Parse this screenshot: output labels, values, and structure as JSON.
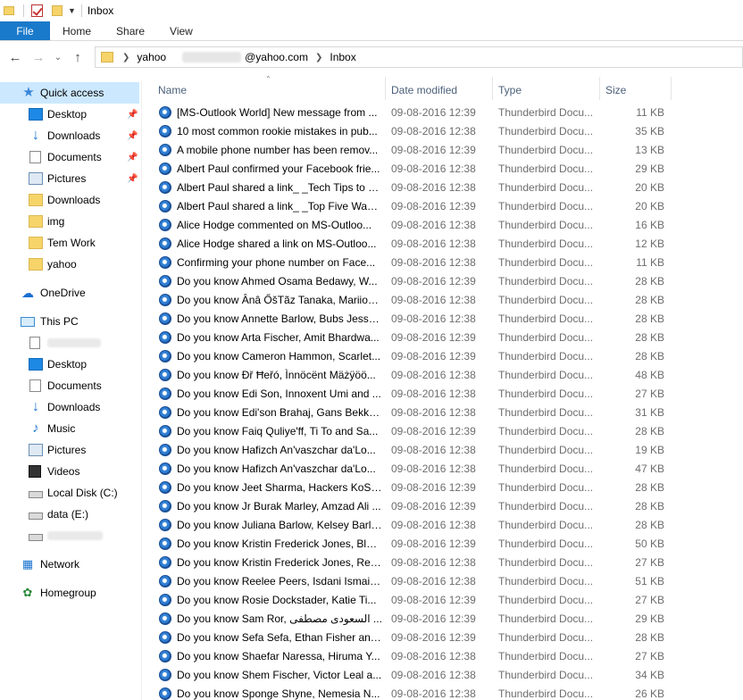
{
  "window": {
    "title": "Inbox"
  },
  "ribbon": {
    "file": "File",
    "home": "Home",
    "share": "Share",
    "view": "View"
  },
  "address": {
    "crumb1": "yahoo",
    "email_suffix": "@yahoo.com",
    "crumb3": "Inbox"
  },
  "nav": {
    "quick_access": "Quick access",
    "desktop": "Desktop",
    "downloads": "Downloads",
    "documents": "Documents",
    "pictures": "Pictures",
    "downloads2": "Downloads",
    "img": "img",
    "tem_work": "Tem Work",
    "yahoo": "yahoo",
    "onedrive": "OneDrive",
    "this_pc": "This PC",
    "pc_desktop": "Desktop",
    "pc_documents": "Documents",
    "pc_downloads": "Downloads",
    "music": "Music",
    "pc_pictures": "Pictures",
    "videos": "Videos",
    "local_disk": "Local Disk (C:)",
    "data_e": "data (E:)",
    "network": "Network",
    "homegroup": "Homegroup"
  },
  "columns": {
    "name": "Name",
    "date_modified": "Date modified",
    "type": "Type",
    "size": "Size"
  },
  "files": [
    {
      "name": "[MS-Outlook World] New message from ...",
      "date": "09-08-2016 12:39",
      "type": "Thunderbird Docu...",
      "size": "11 KB"
    },
    {
      "name": "10 most common rookie mistakes in pub...",
      "date": "09-08-2016 12:38",
      "type": "Thunderbird Docu...",
      "size": "35 KB"
    },
    {
      "name": "A mobile phone number has been remov...",
      "date": "09-08-2016 12:39",
      "type": "Thunderbird Docu...",
      "size": "13 KB"
    },
    {
      "name": "Albert Paul confirmed your Facebook frie...",
      "date": "09-08-2016 12:38",
      "type": "Thunderbird Docu...",
      "size": "29 KB"
    },
    {
      "name": "Albert Paul shared a link_ _Tech Tips to C...",
      "date": "09-08-2016 12:38",
      "type": "Thunderbird Docu...",
      "size": "20 KB"
    },
    {
      "name": "Albert Paul shared a link_ _Top Five Ways...",
      "date": "09-08-2016 12:39",
      "type": "Thunderbird Docu...",
      "size": "20 KB"
    },
    {
      "name": "Alice Hodge commented on MS-Outloo...",
      "date": "09-08-2016 12:38",
      "type": "Thunderbird Docu...",
      "size": "16 KB"
    },
    {
      "name": "Alice Hodge shared a link on MS-Outloo...",
      "date": "09-08-2016 12:38",
      "type": "Thunderbird Docu...",
      "size": "12 KB"
    },
    {
      "name": "Confirming your phone number on Face...",
      "date": "09-08-2016 12:38",
      "type": "Thunderbird Docu...",
      "size": "11 KB"
    },
    {
      "name": "Do you know Ahmed Osama Bedawy, W...",
      "date": "09-08-2016 12:39",
      "type": "Thunderbird Docu...",
      "size": "28 KB"
    },
    {
      "name": "Do you know Ȃnâ ŐšTãz Tanaka, Mariioo...",
      "date": "09-08-2016 12:38",
      "type": "Thunderbird Docu...",
      "size": "28 KB"
    },
    {
      "name": "Do you know Annette Barlow, Bubs Jesso...",
      "date": "09-08-2016 12:38",
      "type": "Thunderbird Docu...",
      "size": "28 KB"
    },
    {
      "name": "Do you know Arta Fischer, Amit Bhardwa...",
      "date": "09-08-2016 12:39",
      "type": "Thunderbird Docu...",
      "size": "28 KB"
    },
    {
      "name": "Do you know Cameron Hammon, Scarlet...",
      "date": "09-08-2016 12:39",
      "type": "Thunderbird Docu...",
      "size": "28 KB"
    },
    {
      "name": "Do you know Đř Ħeřó, Ìnnöcënt Mäżÿöö...",
      "date": "09-08-2016 12:38",
      "type": "Thunderbird Docu...",
      "size": "48 KB"
    },
    {
      "name": "Do you know Edi Son, Innoxent Umi and ...",
      "date": "09-08-2016 12:38",
      "type": "Thunderbird Docu...",
      "size": "27 KB"
    },
    {
      "name": "Do you know Edi'son Brahaj, Gans Bekker...",
      "date": "09-08-2016 12:38",
      "type": "Thunderbird Docu...",
      "size": "31 KB"
    },
    {
      "name": "Do you know Faiq Quliye'ff, Ti To and Sa...",
      "date": "09-08-2016 12:39",
      "type": "Thunderbird Docu...",
      "size": "28 KB"
    },
    {
      "name": "Do you know Hafizch An'vaszchar da'Lo...",
      "date": "09-08-2016 12:38",
      "type": "Thunderbird Docu...",
      "size": "19 KB"
    },
    {
      "name": "Do you know Hafizch An'vaszchar da'Lo...",
      "date": "09-08-2016 12:38",
      "type": "Thunderbird Docu...",
      "size": "47 KB"
    },
    {
      "name": "Do you know Jeet Sharma, Hackers KoSo...",
      "date": "09-08-2016 12:39",
      "type": "Thunderbird Docu...",
      "size": "28 KB"
    },
    {
      "name": "Do you know Jr Burak Marley, Amzad Ali ...",
      "date": "09-08-2016 12:39",
      "type": "Thunderbird Docu...",
      "size": "28 KB"
    },
    {
      "name": "Do you know Juliana Barlow, Kelsey Barlo...",
      "date": "09-08-2016 12:38",
      "type": "Thunderbird Docu...",
      "size": "28 KB"
    },
    {
      "name": "Do you know Kristin Frederick Jones, Bln ...",
      "date": "09-08-2016 12:39",
      "type": "Thunderbird Docu...",
      "size": "50 KB"
    },
    {
      "name": "Do you know Kristin Frederick Jones, Reel...",
      "date": "09-08-2016 12:38",
      "type": "Thunderbird Docu...",
      "size": "27 KB"
    },
    {
      "name": "Do you know Reelee Peers, Isdani Ismail ...",
      "date": "09-08-2016 12:38",
      "type": "Thunderbird Docu...",
      "size": "51 KB"
    },
    {
      "name": "Do you know Rosie Dockstader, Katie Ti...",
      "date": "09-08-2016 12:39",
      "type": "Thunderbird Docu...",
      "size": "27 KB"
    },
    {
      "name": "Do you know Sam Ror, السعودی مصطفی ...",
      "date": "09-08-2016 12:39",
      "type": "Thunderbird Docu...",
      "size": "29 KB"
    },
    {
      "name": "Do you know Sefa Sefa, Ethan Fisher and ...",
      "date": "09-08-2016 12:39",
      "type": "Thunderbird Docu...",
      "size": "28 KB"
    },
    {
      "name": "Do you know Shaefar Naressa, Hiruma Y...",
      "date": "09-08-2016 12:38",
      "type": "Thunderbird Docu...",
      "size": "27 KB"
    },
    {
      "name": "Do you know Shem Fischer, Victor Leal a...",
      "date": "09-08-2016 12:38",
      "type": "Thunderbird Docu...",
      "size": "34 KB"
    },
    {
      "name": "Do you know Sponge Shyne, Nemesia N...",
      "date": "09-08-2016 12:38",
      "type": "Thunderbird Docu...",
      "size": "26 KB"
    }
  ]
}
